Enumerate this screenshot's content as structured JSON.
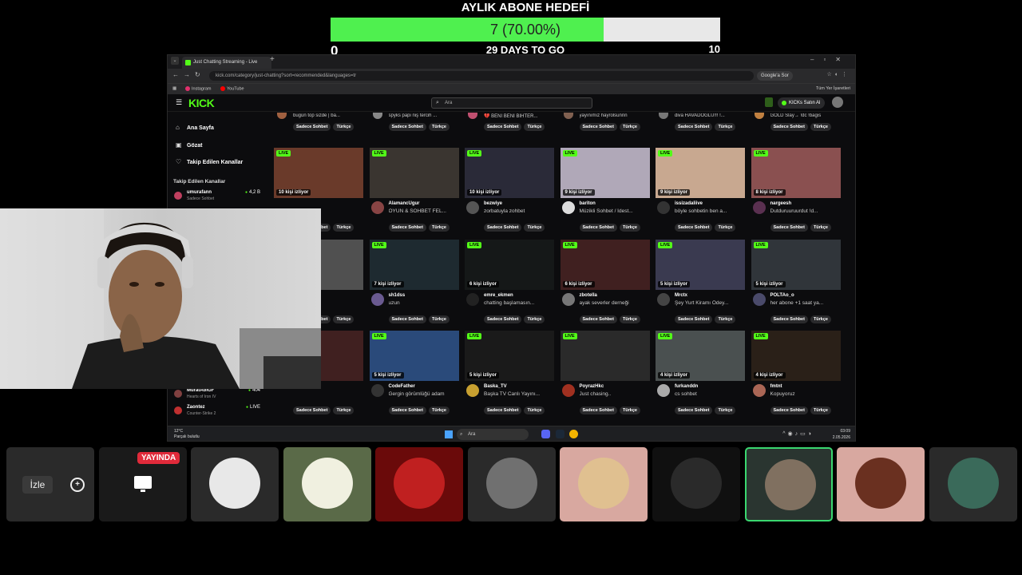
{
  "goal": {
    "title": "AYLIK ABONE HEDEFİ",
    "progress_text": "7 (70.00%)",
    "progress_fraction": 0.7,
    "min": "0",
    "max": "10",
    "days_left": "29 DAYS TO GO"
  },
  "browser": {
    "tab_title": "Just Chatting Streaming - Live",
    "new_tab": "+",
    "url": "kick.com/category/just-chatting?sort=recommended&languages=tr",
    "google_btn": "Google'a Sor",
    "bookmarks": [
      "Instagram",
      "YouTube"
    ],
    "all_bookmarks": "Tüm Yer İşaretleri"
  },
  "kick": {
    "logo": "KICK",
    "search_placeholder": "Ara",
    "buy_kicks": "KICKs Satın Al"
  },
  "sidebar": {
    "nav": [
      {
        "label": "Ana Sayfa",
        "icon": "home-icon"
      },
      {
        "label": "Gözat",
        "icon": "browse-icon"
      },
      {
        "label": "Takip Edilen Kanallar",
        "icon": "heart-icon"
      }
    ],
    "followed_heading": "Takip Edilen Kanallar",
    "channels": [
      {
        "name": "umurafann",
        "category": "Sadece Sohbet",
        "viewers": "4,2 B",
        "color": "#c04060"
      },
      {
        "name": "MuratAbiGF",
        "category": "Hearts of Iron IV",
        "viewers": "404",
        "color": "#804040"
      },
      {
        "name": "Zaontez",
        "category": "Counter-Strike 2",
        "viewers": "LIVE",
        "color": "#c03030"
      }
    ]
  },
  "tags": {
    "chat": "Sadece Sohbet",
    "lang": "Türkçe"
  },
  "top_row": [
    {
      "title": "bugün top sizde | ba...",
      "color": "#a06040"
    },
    {
      "title": "spyks papi niş tercih ...",
      "color": "#888"
    },
    {
      "title": "💔 BENI BENI BIHTER...",
      "color": "#c05070"
    },
    {
      "title": "yayınımız hayrolsunnn",
      "color": "#806050"
    },
    {
      "title": "diva HAVADOGLU!!! !...",
      "color": "#777"
    },
    {
      "title": "GOLD Slay→ !dc !bagis",
      "color": "#c08040"
    }
  ],
  "cards": [
    {
      "viewers": "10 kişi izliyor",
      "name": "",
      "title": "",
      "thumb": "#6a3a2a",
      "av": "#666"
    },
    {
      "viewers": "",
      "name": "AlamancUgur",
      "title": "OYUN & SOHBET FEL...",
      "thumb": "#3a3530",
      "av": "#884444"
    },
    {
      "viewers": "10 kişi izliyor",
      "name": "bezwiye",
      "title": "zorbatuyla zohbet",
      "thumb": "#2a2a38",
      "av": "#555"
    },
    {
      "viewers": "9 kişi izliyor",
      "name": "bariton",
      "title": "Müzikli Sohbet / İdest...",
      "thumb": "#b0a8b8",
      "av": "#ddd"
    },
    {
      "viewers": "9 kişi izliyor",
      "name": "issizadaliive",
      "title": "böyle sohbetin ben a...",
      "thumb": "#c8a890",
      "av": "#333"
    },
    {
      "viewers": "8 kişi izliyor",
      "name": "nargeesh",
      "title": "Dutduruuruurdut !d...",
      "thumb": "#8a5050",
      "av": "#5a3050"
    },
    {
      "viewers": "",
      "name": "temexe",
      "title": "ler OLDU ...",
      "thumb": "#505050",
      "av": "#777"
    },
    {
      "viewers": "7 kişi izliyor",
      "name": "sh1dss",
      "title": "uzun",
      "thumb": "#1e2a30",
      "av": "#6a5a90"
    },
    {
      "viewers": "6 kişi izliyor",
      "name": "emre_ekmen",
      "title": "chatting başlamasın...",
      "thumb": "#151818",
      "av": "#222"
    },
    {
      "viewers": "6 kişi izliyor",
      "name": "zbotella",
      "title": "ayak severler derneği",
      "thumb": "#402020",
      "av": "#777"
    },
    {
      "viewers": "5 kişi izliyor",
      "name": "Mrctx",
      "title": "Şey Yurt Kiramı Ödey...",
      "thumb": "#3a3a50",
      "av": "#444"
    },
    {
      "viewers": "5 kişi izliyor",
      "name": "POLTAo_o",
      "title": "her abone +1 saat ya...",
      "thumb": "#30353a",
      "av": "#4a4a6a"
    },
    {
      "viewers": "",
      "name": "",
      "title": "",
      "thumb": "#402020",
      "av": "#555"
    },
    {
      "viewers": "5 kişi izliyor",
      "name": "CodeFather",
      "title": "Gergin görümlüğü adam",
      "thumb": "#2a4a7a",
      "av": "#333"
    },
    {
      "viewers": "5 kişi izliyor",
      "name": "Baska_TV",
      "title": "Başka TV Canlı Yayını...",
      "thumb": "#1a1a1a",
      "av": "#c8a030"
    },
    {
      "viewers": "",
      "name": "PoyrazHkc",
      "title": "Just chasing..",
      "thumb": "#2a2a2a",
      "av": "#a03020"
    },
    {
      "viewers": "4 kişi izliyor",
      "name": "furkanddn",
      "title": "cs sohbet",
      "thumb": "#4a5050",
      "av": "#aaa"
    },
    {
      "viewers": "4 kişi izliyor",
      "name": "fmtnt",
      "title": "Kopuyoruz",
      "thumb": "#2a2018",
      "av": "#aa6655"
    }
  ],
  "taskbar": {
    "weather_temp": "12°C",
    "weather_desc": "Parçalı bulutlu",
    "search": "Ara",
    "time": "03:09",
    "date": "2.05.2026"
  },
  "strip": {
    "watch_label": "İzle",
    "live_badge": "YAYINDA",
    "avatars": [
      {
        "name": "anime-avatar",
        "bg": "#2a2a2a",
        "fg": "#e8e8e8"
      },
      {
        "name": "chicken-avatar",
        "bg": "#5a6a48",
        "fg": "#f0f0e0"
      },
      {
        "name": "red-webcam-avatar",
        "bg": "#6a0a0a",
        "fg": "#c02020"
      },
      {
        "name": "hat-man-avatar",
        "bg": "#2a2a2a",
        "fg": "#707070"
      },
      {
        "name": "blonde-avatar",
        "bg": "#d8a8a0",
        "fg": "#e0c090"
      },
      {
        "name": "dark-avatar",
        "bg": "#101010",
        "fg": "#2a2a2a"
      },
      {
        "name": "man-avatar-selected",
        "bg": "#2a3530",
        "fg": "#807060"
      },
      {
        "name": "woman-avatar",
        "bg": "#d8a8a0",
        "fg": "#6a3020"
      },
      {
        "name": "car-avatar",
        "bg": "#2a2a2a",
        "fg": "#3a6a5a"
      }
    ]
  },
  "colors": {
    "kick_green": "#53fc18",
    "goal_fill": "#4ff04f",
    "live_red": "#e02a3a",
    "selected_border": "#3ad870"
  }
}
